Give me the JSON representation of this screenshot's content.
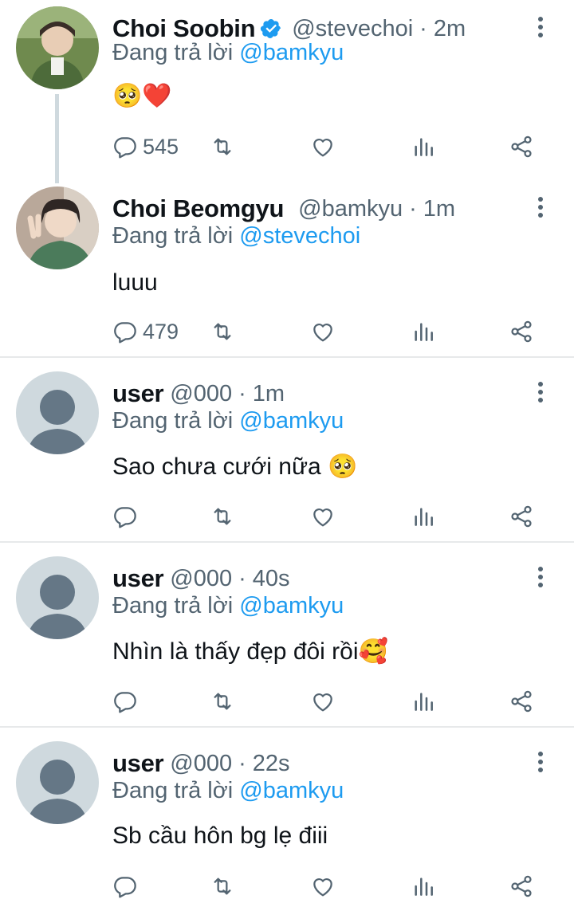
{
  "reply_prefix": "Đang trả lời",
  "tweets": [
    {
      "name": "Choi Soobin",
      "verified": true,
      "handle": "@stevechoi",
      "time": "2m",
      "reply_to": "@bamkyu",
      "text": "🥺❤️",
      "replies": "545"
    },
    {
      "name": "Choi Beomgyu",
      "verified": false,
      "handle": "@bamkyu",
      "time": "1m",
      "reply_to": "@stevechoi",
      "text": "luuu",
      "replies": "479"
    },
    {
      "name": "user",
      "verified": false,
      "handle": "@000",
      "time": "1m",
      "reply_to": "@bamkyu",
      "text": "Sao chưa cưới nữa 🥺",
      "replies": ""
    },
    {
      "name": "user",
      "verified": false,
      "handle": "@000",
      "time": "40s",
      "reply_to": "@bamkyu",
      "text": "Nhìn là thấy đẹp đôi rồi🥰",
      "replies": ""
    },
    {
      "name": "user",
      "verified": false,
      "handle": "@000",
      "time": "22s",
      "reply_to": "@bamkyu",
      "text": "Sb cầu hôn bg lẹ điii",
      "replies": ""
    }
  ],
  "colors": {
    "link": "#1d9bf0",
    "muted": "#536471",
    "text": "#0f1419",
    "divider": "#e7e9ea",
    "verified": "#1d9bf0",
    "placeholder_bg": "#cfd9de",
    "placeholder_fg": "#657786"
  }
}
